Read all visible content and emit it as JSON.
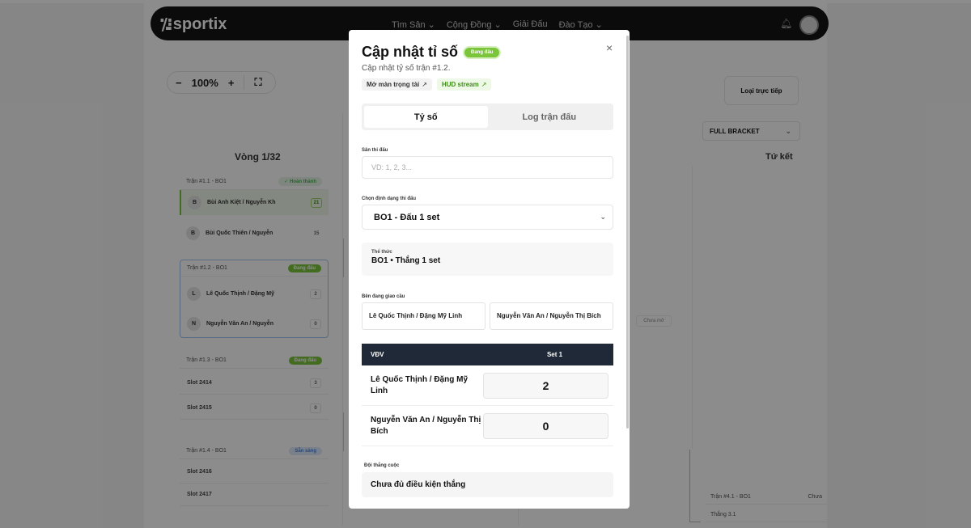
{
  "nav": {
    "logo": "sportix",
    "items": [
      "Tìm Sân ⌄",
      "Cộng Đồng ⌄",
      "Giải Đấu",
      "Đào Tạo ⌄"
    ]
  },
  "toolbar": {
    "zoom_out": "−",
    "zoom_level": "100%",
    "zoom_in": "+",
    "fit": "⛶",
    "live_button": "Loại trực tiếp",
    "bracket_select": "FULL BRACKET"
  },
  "bracket": {
    "round_title": "Vòng 1/32",
    "quarter_title": "Tứ kết",
    "matches": [
      {
        "head": "Trận #1.1 - BO1",
        "status": "✓ Hoàn thành",
        "teams": [
          {
            "avatar": "B",
            "name": "Bùi Anh Kiệt / Nguyễn Kh",
            "score": "21"
          },
          {
            "avatar": "B",
            "name": "Bùi Quốc Thiên / Nguyễn",
            "score": "15"
          }
        ]
      },
      {
        "head": "Trận #1.2 - BO1",
        "status": "Đang đấu",
        "teams": [
          {
            "avatar": "L",
            "name": "Lê Quốc Thịnh / Đặng Mỹ",
            "score": "2"
          },
          {
            "avatar": "N",
            "name": "Nguyễn Văn An / Nguyễn",
            "score": "0"
          }
        ]
      },
      {
        "head": "Trận #1.3 - BO1",
        "status": "Đang đấu",
        "slots": [
          {
            "name": "Slot 2414",
            "score": "3"
          },
          {
            "name": "Slot 2415",
            "score": "0"
          }
        ]
      },
      {
        "head": "Trận #1.4 - BO1",
        "status": "Sẵn sàng",
        "slots": [
          {
            "name": "Slot 2416"
          },
          {
            "name": "Slot 2417"
          }
        ]
      }
    ],
    "unopened": "Chưa mở",
    "qf_match": {
      "head": "Trận #4.1 - BO1",
      "status": "Chưa",
      "team": "Thắng 3.1"
    }
  },
  "modal": {
    "title": "Cập nhật tỉ số",
    "status_badge": "Đang đấu",
    "close": "×",
    "subtitle": "Cập nhật tỷ số trận #1.2.",
    "link_court": "Mở màn trọng tài",
    "link_hud": "HUD stream",
    "tabs": [
      "Tỷ số",
      "Log trận đấu"
    ],
    "court_label": "Sân thi đấu",
    "court_placeholder": "VD: 1, 2, 3...",
    "format_label": "Chọn định dạng thi đấu",
    "format_value": "BO1 - Đấu 1 set",
    "rule_label": "Thể thức",
    "rule_value": "BO1 • Thắng 1 set",
    "serve_label": "Bên đang giao cầu",
    "serve_options": [
      "Lê Quốc Thịnh / Đặng Mỹ Linh",
      "Nguyễn Văn An / Nguyễn Thị Bích"
    ],
    "table_head": {
      "player": "VĐV",
      "set1": "Set 1"
    },
    "scores": [
      {
        "name": "Lê Quốc Thịnh / Đặng Mỹ Linh",
        "set1": "2"
      },
      {
        "name": "Nguyễn Văn An / Nguyễn Thị Bích",
        "set1": "0"
      }
    ],
    "winner_label": "Đội thắng cuộc",
    "winner_value": "Chưa đủ điều kiện thắng"
  }
}
